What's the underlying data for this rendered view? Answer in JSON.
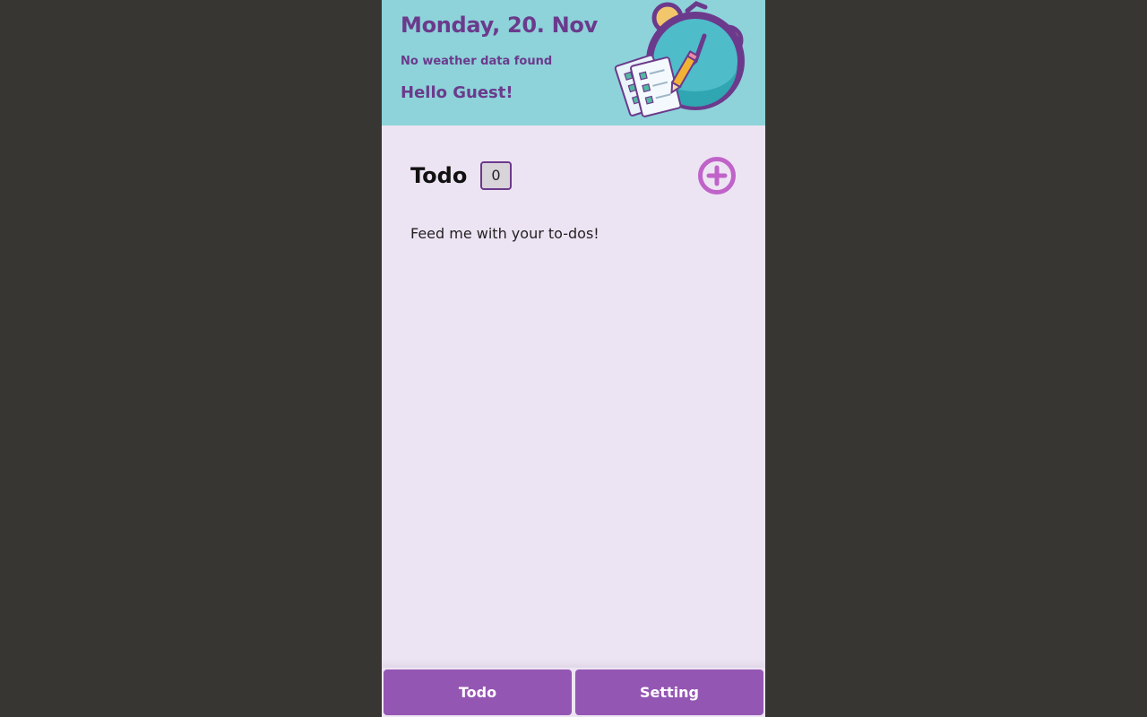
{
  "header": {
    "date": "Monday, 20. Nov",
    "weather": "No weather data found",
    "greeting": "Hello Guest!",
    "illustration_icon": "alarm-clock-checklist-icon",
    "background_color": "#8dd3d9",
    "text_color": "#6b3a8c"
  },
  "todo": {
    "title": "Todo",
    "count": "0",
    "add_icon": "plus-circle-icon",
    "empty_message": "Feed me with your to-dos!"
  },
  "nav": {
    "todo_label": "Todo",
    "setting_label": "Setting",
    "button_color": "#9456b3"
  }
}
